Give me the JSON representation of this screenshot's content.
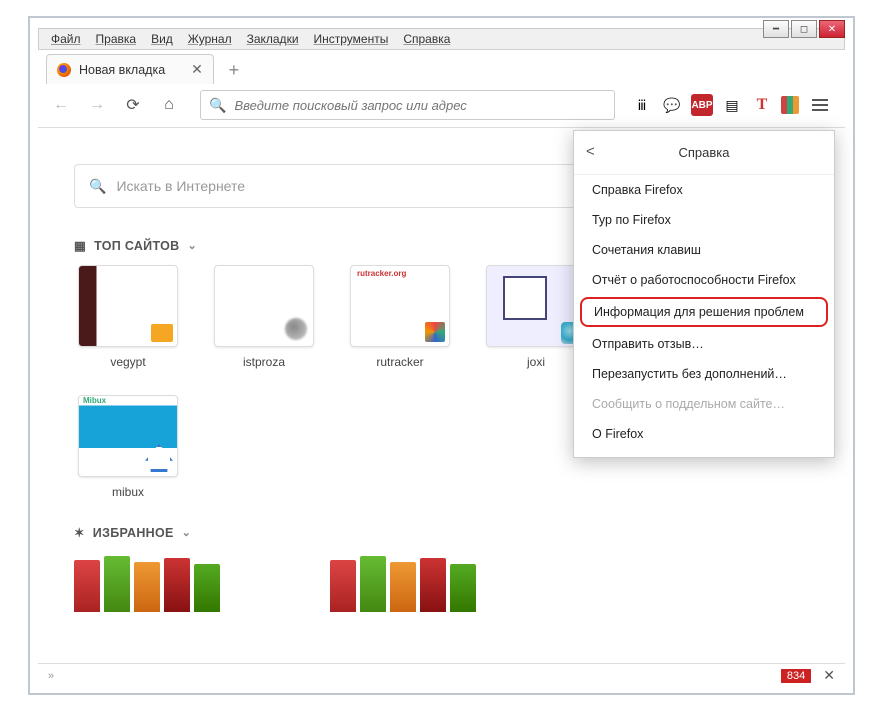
{
  "menubar": {
    "items": [
      "Файл",
      "Правка",
      "Вид",
      "Журнал",
      "Закладки",
      "Инструменты",
      "Справка"
    ]
  },
  "tab": {
    "title": "Новая вкладка"
  },
  "urlbar": {
    "placeholder": "Введите поисковый запрос или адрес"
  },
  "content": {
    "search_placeholder": "Искать в Интернете",
    "top_sites_label": "ТОП САЙТОВ",
    "favorites_label": "ИЗБРАННОЕ",
    "tiles": [
      {
        "label": "vegypt",
        "thumb": "t-vegypt"
      },
      {
        "label": "istproza",
        "thumb": "t-istproza"
      },
      {
        "label": "rutracker",
        "thumb": "t-rutracker"
      },
      {
        "label": "joxi",
        "thumb": "t-joxi"
      },
      {
        "label": "mibux",
        "thumb": "t-mibux"
      }
    ]
  },
  "help_panel": {
    "title": "Справка",
    "items": [
      {
        "label": "Справка Firefox"
      },
      {
        "label": "Тур по Firefox"
      },
      {
        "label": "Сочетания клавиш"
      },
      {
        "label": "Отчёт о работоспособности Firefox"
      },
      {
        "label": "Информация для решения проблем",
        "highlight": true
      },
      {
        "label": "Отправить отзыв…"
      },
      {
        "label": "Перезапустить без дополнений…"
      },
      {
        "label": "Сообщить о поддельном сайте…",
        "disabled": true
      },
      {
        "label": "О Firefox"
      }
    ]
  },
  "statusbar": {
    "badge": "834"
  }
}
